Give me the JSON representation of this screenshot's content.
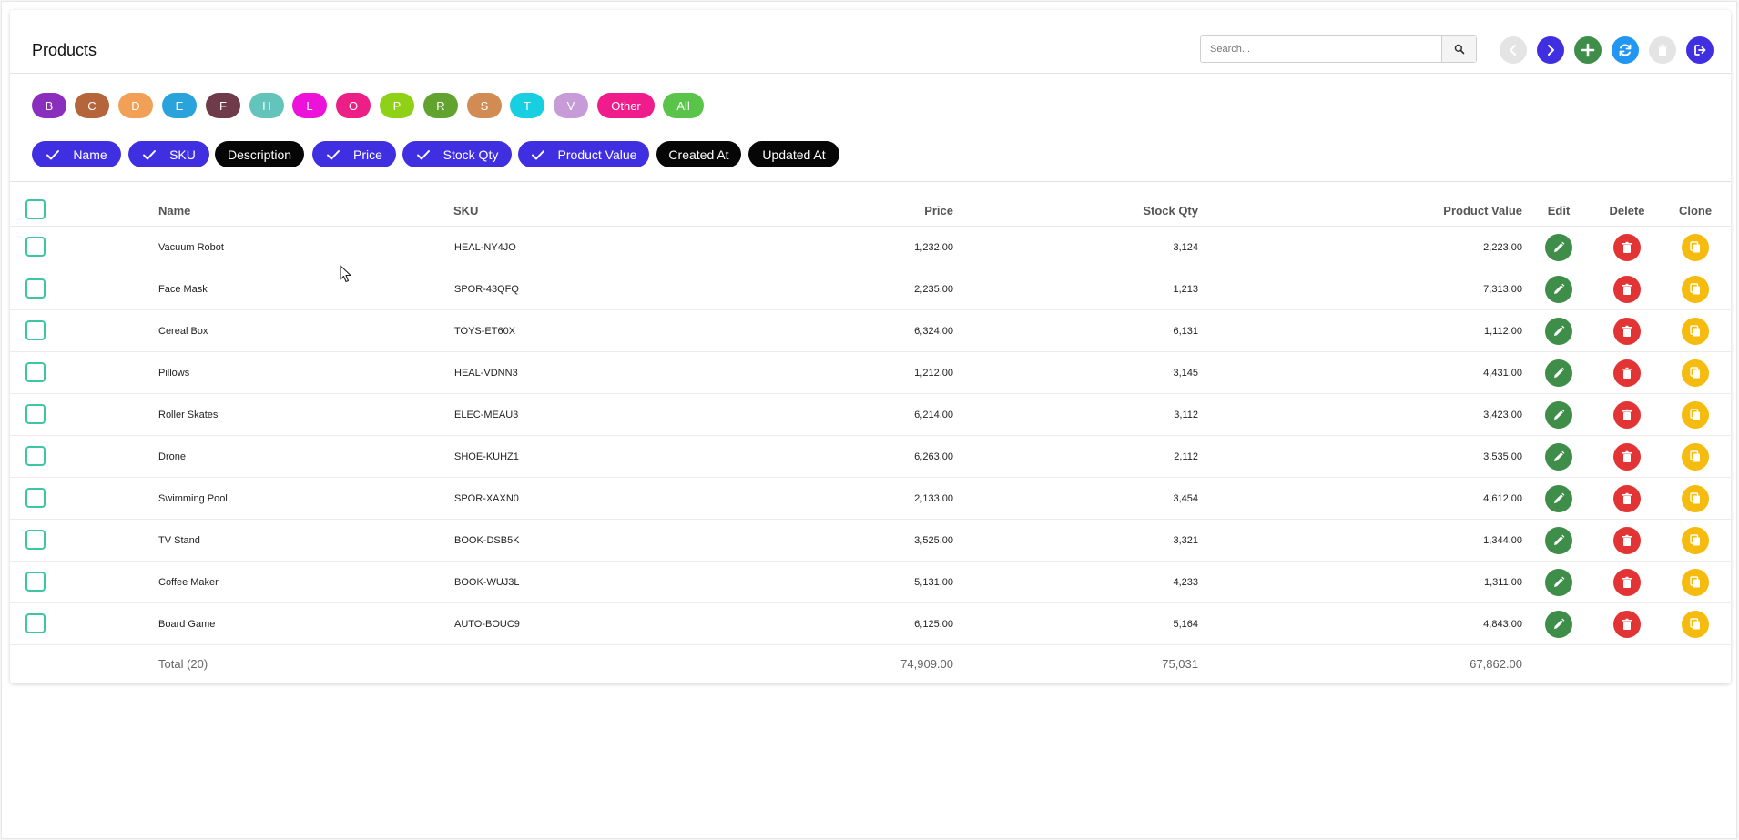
{
  "header": {
    "title": "Products",
    "search_placeholder": "Search..."
  },
  "letter_filters": [
    {
      "label": "B",
      "color": "#8a2fbd"
    },
    {
      "label": "C",
      "color": "#b5653b"
    },
    {
      "label": "D",
      "color": "#f1a055"
    },
    {
      "label": "E",
      "color": "#2aa3dc"
    },
    {
      "label": "F",
      "color": "#6f3a4a"
    },
    {
      "label": "H",
      "color": "#63c4bb"
    },
    {
      "label": "L",
      "color": "#ec12d9"
    },
    {
      "label": "O",
      "color": "#ec1f86"
    },
    {
      "label": "P",
      "color": "#8ed117"
    },
    {
      "label": "R",
      "color": "#62a32f"
    },
    {
      "label": "S",
      "color": "#d28b52"
    },
    {
      "label": "T",
      "color": "#17cfe0"
    },
    {
      "label": "V",
      "color": "#c79ad8"
    },
    {
      "label": "Other",
      "color": "#f01c8c"
    },
    {
      "label": "All",
      "color": "#59c34a"
    }
  ],
  "column_toggles": [
    {
      "label": "Name",
      "checked": true
    },
    {
      "label": "SKU",
      "checked": true
    },
    {
      "label": "Description",
      "checked": false
    },
    {
      "label": "Price",
      "checked": true
    },
    {
      "label": "Stock Qty",
      "checked": true
    },
    {
      "label": "Product Value",
      "checked": true
    },
    {
      "label": "Created At",
      "checked": false
    },
    {
      "label": "Updated At",
      "checked": false
    }
  ],
  "table": {
    "headers": {
      "name": "Name",
      "sku": "SKU",
      "price": "Price",
      "stock": "Stock Qty",
      "value": "Product Value",
      "edit": "Edit",
      "delete": "Delete",
      "clone": "Clone"
    },
    "rows": [
      {
        "name": "Vacuum Robot",
        "sku": "HEAL-NY4JO",
        "price": "1,232.00",
        "stock": "3,124",
        "value": "2,223.00"
      },
      {
        "name": "Face Mask",
        "sku": "SPOR-43QFQ",
        "price": "2,235.00",
        "stock": "1,213",
        "value": "7,313.00"
      },
      {
        "name": "Cereal Box",
        "sku": "TOYS-ET60X",
        "price": "6,324.00",
        "stock": "6,131",
        "value": "1,112.00"
      },
      {
        "name": "Pillows",
        "sku": "HEAL-VDNN3",
        "price": "1,212.00",
        "stock": "3,145",
        "value": "4,431.00"
      },
      {
        "name": "Roller Skates",
        "sku": "ELEC-MEAU3",
        "price": "6,214.00",
        "stock": "3,112",
        "value": "3,423.00"
      },
      {
        "name": "Drone",
        "sku": "SHOE-KUHZ1",
        "price": "6,263.00",
        "stock": "2,112",
        "value": "3,535.00"
      },
      {
        "name": "Swimming Pool",
        "sku": "SPOR-XAXN0",
        "price": "2,133.00",
        "stock": "3,454",
        "value": "4,612.00"
      },
      {
        "name": "TV Stand",
        "sku": "BOOK-DSB5K",
        "price": "3,525.00",
        "stock": "3,321",
        "value": "1,344.00"
      },
      {
        "name": "Coffee Maker",
        "sku": "BOOK-WUJ3L",
        "price": "5,131.00",
        "stock": "4,233",
        "value": "1,311.00"
      },
      {
        "name": "Board Game",
        "sku": "AUTO-BOUC9",
        "price": "6,125.00",
        "stock": "5,164",
        "value": "4,843.00"
      }
    ],
    "footer": {
      "label": "Total (20)",
      "price": "74,909.00",
      "stock": "75,031",
      "value": "67,862.00"
    }
  },
  "colors": {
    "primary": "#3f2fe0",
    "add": "#3e8e4a",
    "refresh": "#2196f3",
    "edit": "#3e8e4a",
    "delete": "#e23434",
    "clone": "#f5bb0e",
    "checkbox": "#3ec6a4"
  }
}
